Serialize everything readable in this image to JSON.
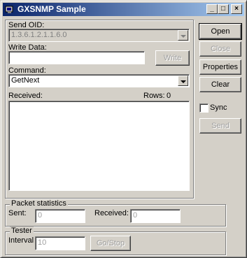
{
  "window": {
    "title": "GXSNMP Sample",
    "controls": {
      "minimize": "_",
      "maximize": "□",
      "close": "×"
    }
  },
  "send_oid": {
    "label": "Send OID:",
    "value": "1.3.6.1.2.1.1.6.0"
  },
  "write_data": {
    "label": "Write Data:",
    "value": "",
    "button": "Write"
  },
  "command": {
    "label": "Command:",
    "value": "GetNext"
  },
  "received": {
    "label": "Received:",
    "rows_label": "Rows:",
    "rows_value": "0"
  },
  "buttons": {
    "open": "Open",
    "close": "Close",
    "properties": "Properties",
    "clear": "Clear",
    "send": "Send"
  },
  "sync": {
    "label": "Sync",
    "checked": false
  },
  "packet_statistics": {
    "title": "Packet statistics",
    "sent_label": "Sent:",
    "sent_value": "0",
    "received_label": "Received:",
    "received_value": "0"
  },
  "tester": {
    "title": "Tester",
    "interval_label": "Interval",
    "interval_value": "10",
    "go_stop": "Go/Stop"
  }
}
